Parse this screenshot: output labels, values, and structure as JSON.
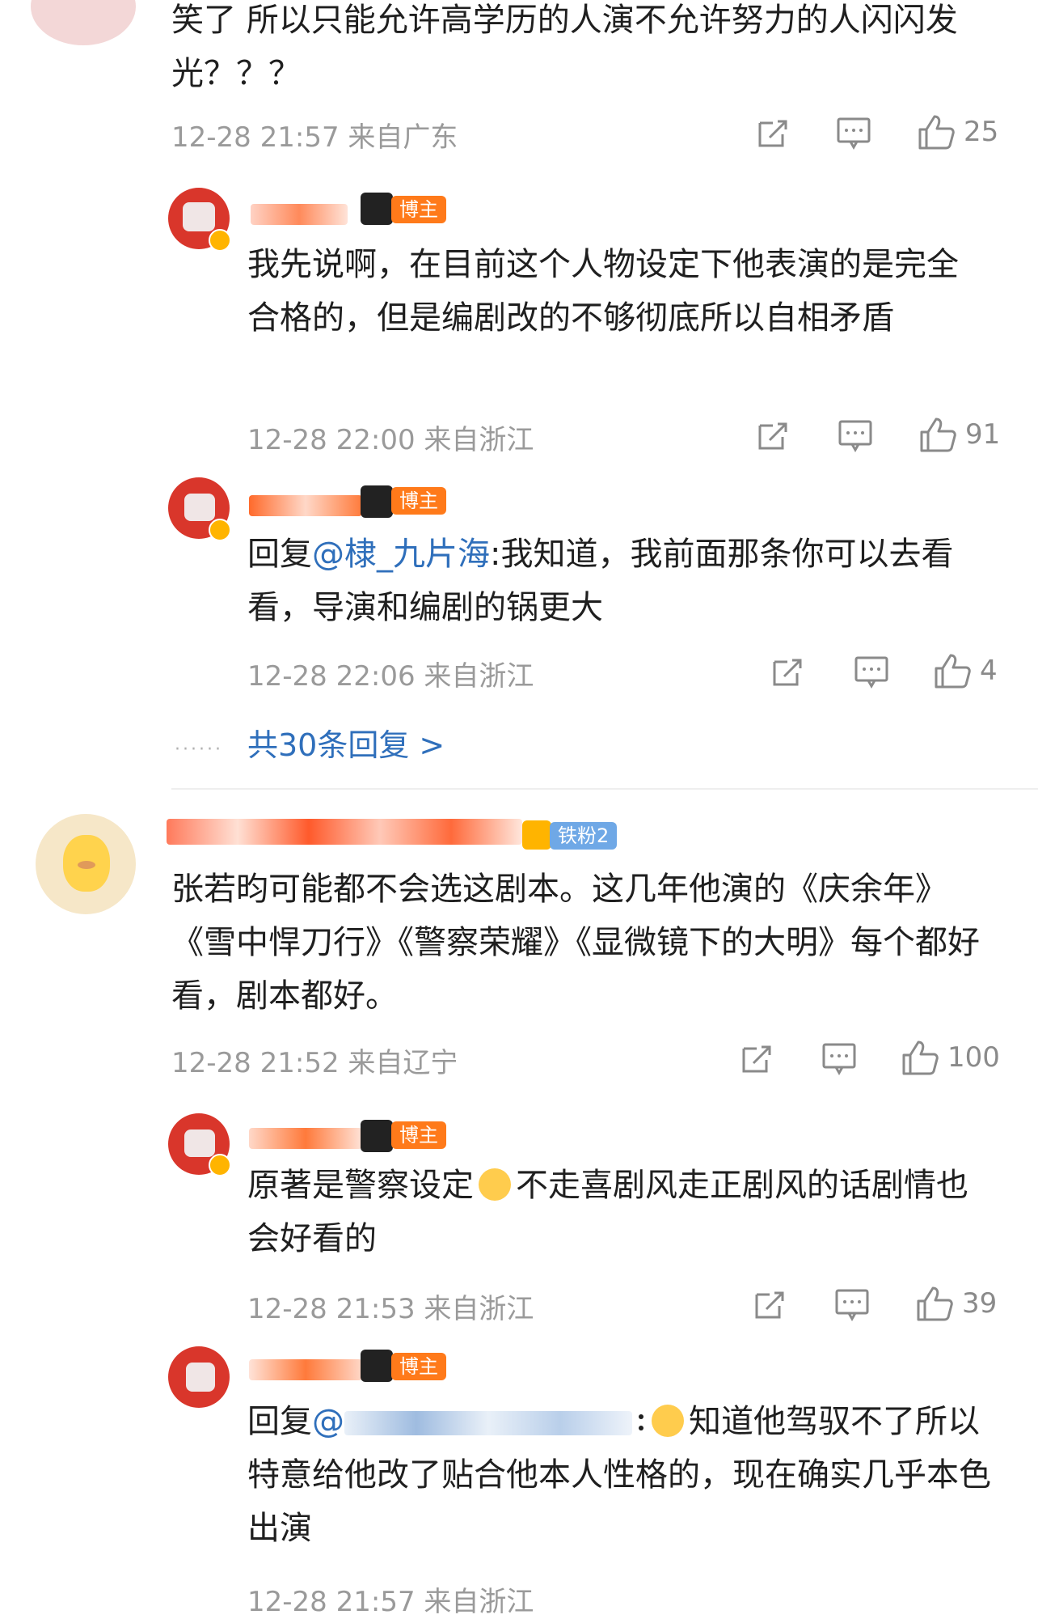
{
  "comments": [
    {
      "text": "笑了 所以只能允许高学历的人演不允许努力的人闪闪发光？？？",
      "meta": "12-28 21:57 来自广东",
      "likes": "25",
      "replies": [
        {
          "badge": "博主",
          "text": "我先说啊，在目前这个人物设定下他表演的是完全合格的，但是编剧改的不够彻底所以自相矛盾",
          "meta": "12-28 22:00 来自浙江",
          "likes": "91"
        },
        {
          "badge": "博主",
          "reply_prefix": "回复",
          "mention": "@棣_九片海",
          "text": ":我知道，我前面那条你可以去看看，导演和编剧的锅更大",
          "meta": "12-28 22:06 来自浙江",
          "likes": "4"
        }
      ],
      "more_replies": "共30条回复 >"
    },
    {
      "badge": "铁粉2",
      "text": "张若昀可能都不会选这剧本。这几年他演的《庆余年》《雪中悍刀行》《警察荣耀》《显微镜下的大明》每个都好看，剧本都好。",
      "meta": "12-28 21:52 来自辽宁",
      "likes": "100",
      "replies": [
        {
          "badge": "博主",
          "text_a": "原著是警察设定",
          "text_b": "不走喜剧风走正剧风的话剧情也会好看的",
          "meta": "12-28 21:53 来自浙江",
          "likes": "39"
        },
        {
          "badge": "博主",
          "reply_prefix": "回复",
          "mention": "@",
          "text_b": "知道他驾驭不了所以特意给他改了贴合他本人性格的，现在确实几乎本色出演",
          "meta": "12-28 21:57 来自浙江"
        }
      ]
    }
  ],
  "icons": {
    "share": "share-icon",
    "comment": "comment-icon",
    "like": "thumbs-up-icon",
    "emoji": "emoji-icon",
    "verified": "verified-icon"
  },
  "colors": {
    "link": "#2f6fbb",
    "badge": "#ff7a1a",
    "fan_badge": "#6fa8e6",
    "meta": "#9a9a9a"
  }
}
